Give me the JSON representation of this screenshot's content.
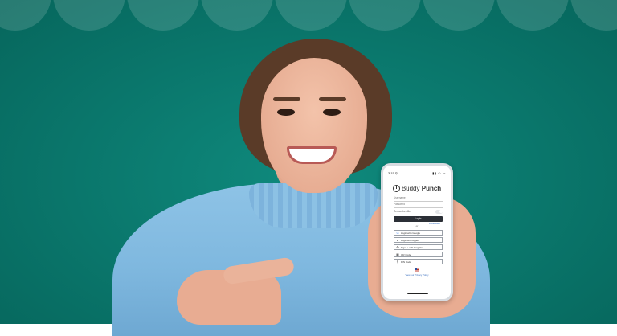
{
  "phone": {
    "status": {
      "time": "3:15 ⚲",
      "icons": "▮▮ ◠ ▭"
    },
    "logo": {
      "word1": "Buddy",
      "word2": "Punch"
    },
    "fields": {
      "username": "Username",
      "password": "Password"
    },
    "remember_label": "Remember Me",
    "forgot_label": "Reset Here",
    "login_label": "Login",
    "or_label": "or",
    "sso": [
      {
        "icon": "google-icon",
        "label": "Login with Google"
      },
      {
        "icon": "apple-icon",
        "label": "Login with Apple"
      },
      {
        "icon": "sso-icon",
        "label": "Sign in with Sing On"
      },
      {
        "icon": "qr-code-icon",
        "label": "QR Code"
      },
      {
        "icon": "pin-icon",
        "label": "PIN Code"
      }
    ],
    "privacy_label": "View our Privacy Policy"
  }
}
